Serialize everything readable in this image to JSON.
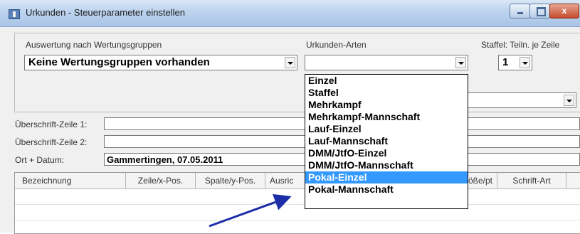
{
  "window": {
    "title": "Urkunden - Steuerparameter einstellen",
    "close_glyph": "x"
  },
  "labels": {
    "auswertung": "Auswertung nach Wertungsgruppen",
    "urkunden_arten": "Urkunden-Arten",
    "staffel": "Staffel: Teiln. je Zeile",
    "ueberschrift1": "Überschrift-Zeile 1:",
    "ueberschrift2": "Überschrift-Zeile 2:",
    "ort_datum": "Ort + Datum:"
  },
  "fields": {
    "wertungsgruppen_value": "Keine Wertungsgruppen vorhanden",
    "urkunden_arten_value": "",
    "staffel_value": "1",
    "ueberschrift1_value": "",
    "ueberschrift2_value": "",
    "ort_datum_value": "Gammertingen, 07.05.2011"
  },
  "grid": {
    "columns": [
      "Bezeichnung",
      "Zeile/x-Pos.",
      "Spalte/y-Pos.",
      "Ausric",
      "Größe/pt",
      "Schrift-Art"
    ]
  },
  "dropdown": {
    "items": [
      "Einzel",
      "Staffel",
      "Mehrkampf",
      "Mehrkampf-Mannschaft",
      "Lauf-Einzel",
      "Lauf-Mannschaft",
      "DMM/JtfO-Einzel",
      "DMM/JtfO-Mannschaft",
      "Pokal-Einzel",
      "Pokal-Mannschaft"
    ],
    "selected": "Pokal-Einzel"
  },
  "annotation": {
    "arrow_color": "#1d2fa8"
  },
  "colors": {
    "selection": "#3399ff",
    "titlebar": "#bcd3ee"
  }
}
